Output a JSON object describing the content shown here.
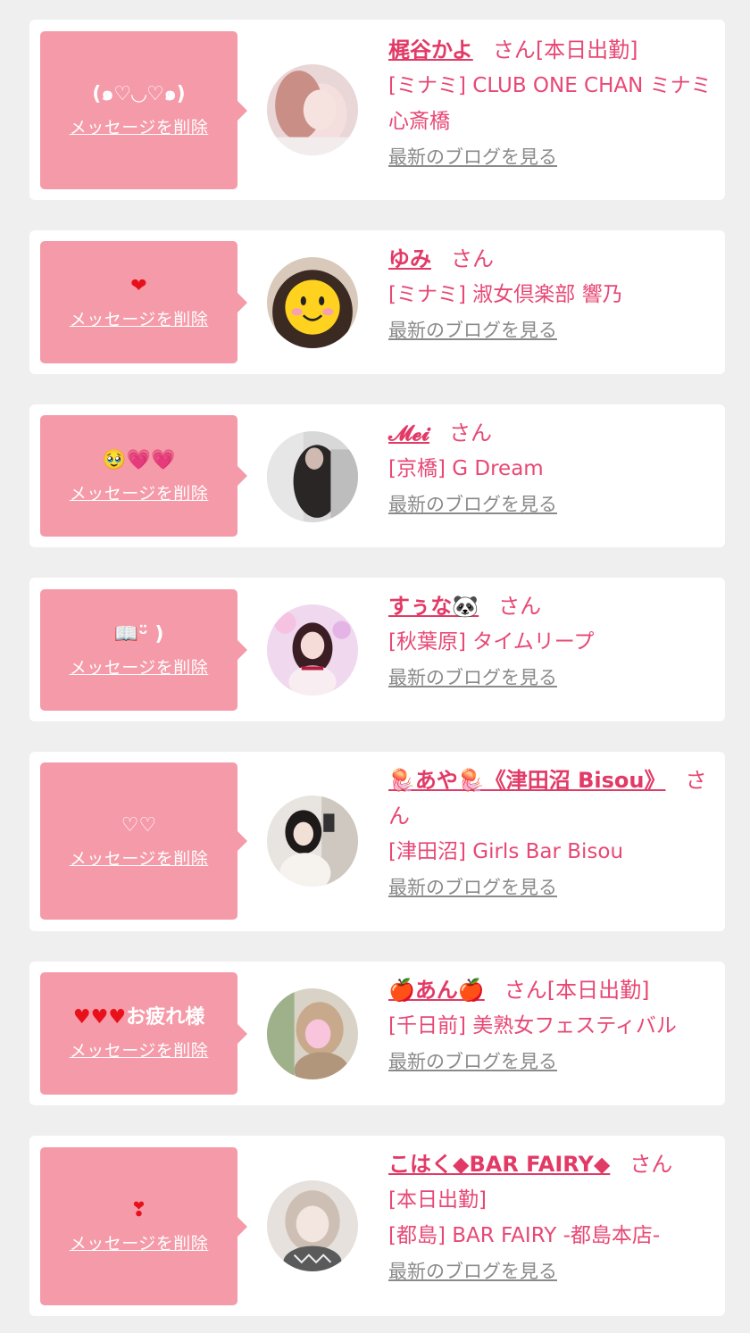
{
  "delete_label": "メッセージを削除",
  "blog_label": "最新のブログを見る",
  "honorific": "さん",
  "entries": [
    {
      "message": "(๑♡◡♡๑)",
      "name": "梶谷かよ",
      "status": "[本日出勤]",
      "shop": "[ミナミ] CLUB ONE CHAN ミナミ 心斎橋"
    },
    {
      "message": "❤",
      "name": "ゆみ",
      "status": "",
      "shop": "[ミナミ] 淑女倶楽部 響乃"
    },
    {
      "message": "🥹💗💗",
      "name": "𝓜𝓮𝓲",
      "status": "",
      "shop": "[京橋] G Dream"
    },
    {
      "message": "📖ᵕ̈ )",
      "name": "すぅな🐼",
      "status": "",
      "shop": "[秋葉原] タイムリープ"
    },
    {
      "message": "♡♡",
      "name": "🪼あや🪼《津田沼 Bisou》",
      "status": "",
      "shop": "[津田沼] Girls Bar Bisou"
    },
    {
      "message_hearts": "♥♥♥",
      "message": "お疲れ様",
      "name": "🍎あん🍎",
      "status": "[本日出勤]",
      "shop": "[千日前] 美熟女フェスティバル"
    },
    {
      "message": "❣",
      "name": "こはく◆BAR FAIRY◆",
      "status": "[本日出勤]",
      "shop": "[都島] BAR FAIRY -都島本店-"
    }
  ]
}
